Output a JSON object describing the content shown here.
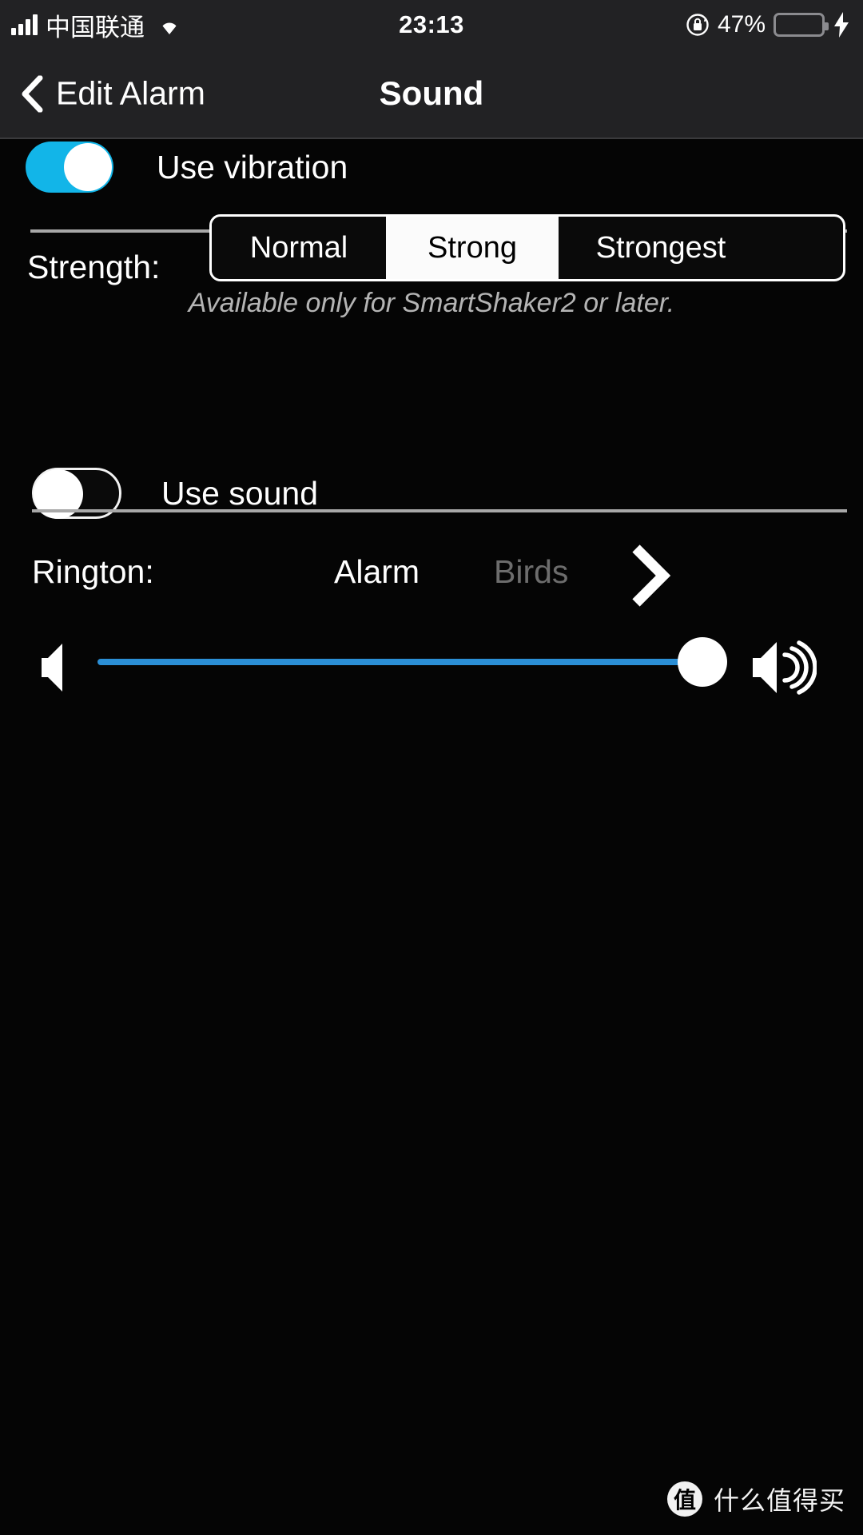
{
  "status_bar": {
    "carrier": "中国联通",
    "time": "23:13",
    "battery_percent": "47%",
    "icons": {
      "signal": "signal-bars-icon",
      "wifi": "wifi-icon",
      "rotation_lock": "rotation-lock-icon",
      "battery": "battery-icon",
      "charging": "charging-bolt-icon"
    },
    "battery_fill_color": "#4cd764"
  },
  "nav": {
    "back_label": "Edit Alarm",
    "title": "Sound",
    "back_icon": "chevron-left-icon"
  },
  "vibration": {
    "toggle_label": "Use vibration",
    "toggle_state": "on",
    "accent_color": "#12b5e8"
  },
  "strength": {
    "label": "Strength:",
    "options": [
      "Normal",
      "Strong",
      "Strongest"
    ],
    "selected": "Strong",
    "hint": "Available only for SmartShaker2 or later."
  },
  "sound": {
    "toggle_label": "Use sound",
    "toggle_state": "off"
  },
  "rington": {
    "label": "Rington:",
    "current": "Alarm",
    "next": "Birds",
    "arrow_icon": "chevron-right-icon"
  },
  "volume": {
    "min_icon": "speaker-low-icon",
    "max_icon": "speaker-high-icon",
    "value": 96,
    "track_color": "#2b8fd6"
  },
  "watermark": {
    "logo": "值",
    "text": "什么值得买"
  }
}
